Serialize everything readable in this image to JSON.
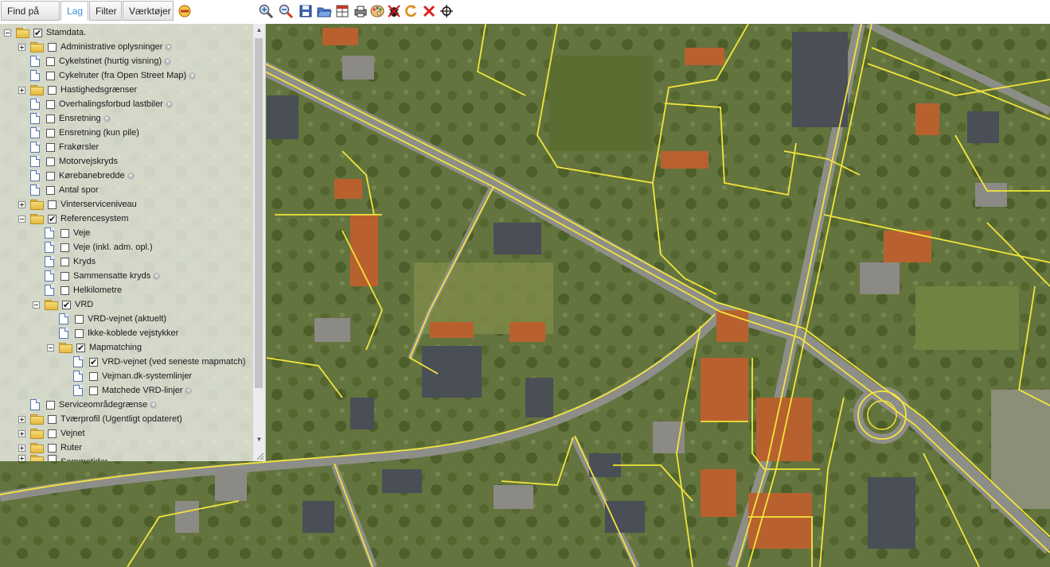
{
  "toolbar": {
    "tabs": [
      {
        "label": "Find på kort",
        "active": false
      },
      {
        "label": "Lag",
        "active": true
      },
      {
        "label": "Filter",
        "active": false
      },
      {
        "label": "Værktøjer",
        "active": false
      }
    ],
    "icons": [
      "minimize-icon",
      "zoom-in-icon",
      "zoom-out-icon",
      "save-icon",
      "open-folder-icon",
      "table-icon",
      "print-icon",
      "palette-icon",
      "bug-icon",
      "refresh-icon",
      "close-icon",
      "crosshair-icon"
    ]
  },
  "layers": [
    {
      "label": "Stamdata.",
      "checked": true
    },
    {
      "label": "Administrative oplysninger",
      "checked": false
    },
    {
      "label": "Cykelstinet (hurtig visning)",
      "checked": false
    },
    {
      "label": "Cykelruter (fra Open Street Map)",
      "checked": false
    },
    {
      "label": "Hastighedsgrænser",
      "checked": false
    },
    {
      "label": "Overhalingsforbud lastbiler",
      "checked": false
    },
    {
      "label": "Ensretning",
      "checked": false
    },
    {
      "label": "Ensretning (kun pile)",
      "checked": false
    },
    {
      "label": "Frakørsler",
      "checked": false
    },
    {
      "label": "Motorvejskryds",
      "checked": false
    },
    {
      "label": "Kørebanebredde",
      "checked": false
    },
    {
      "label": "Antal spor",
      "checked": false
    },
    {
      "label": "Vinterserviceniveau",
      "checked": false
    },
    {
      "label": "Referencesystem",
      "checked": true
    },
    {
      "label": "Veje",
      "checked": false
    },
    {
      "label": "Veje (inkl. adm. opl.)",
      "checked": false
    },
    {
      "label": "Kryds",
      "checked": false
    },
    {
      "label": "Sammensatte kryds",
      "checked": false
    },
    {
      "label": "Helkilometre",
      "checked": false
    },
    {
      "label": "VRD",
      "checked": true
    },
    {
      "label": "VRD-vejnet (aktuelt)",
      "checked": false
    },
    {
      "label": "Ikke-koblede vejstykker",
      "checked": false
    },
    {
      "label": "Mapmatching",
      "checked": true
    },
    {
      "label": "VRD-vejnet (ved seneste mapmatch)",
      "checked": true
    },
    {
      "label": "Vejman.dk-systemlinjer",
      "checked": false
    },
    {
      "label": "Matchede VRD-linjer",
      "checked": false
    },
    {
      "label": "Serviceområdegrænse",
      "checked": false
    },
    {
      "label": "Tværprofil (Ugentligt opdateret)",
      "checked": false
    },
    {
      "label": "Vejnet",
      "checked": false
    },
    {
      "label": "Ruter",
      "checked": false
    },
    {
      "label": "Sammetider",
      "checked": false
    }
  ],
  "colors": {
    "road_line": "#f2e63a",
    "active_tab": "#3a8ddb"
  }
}
